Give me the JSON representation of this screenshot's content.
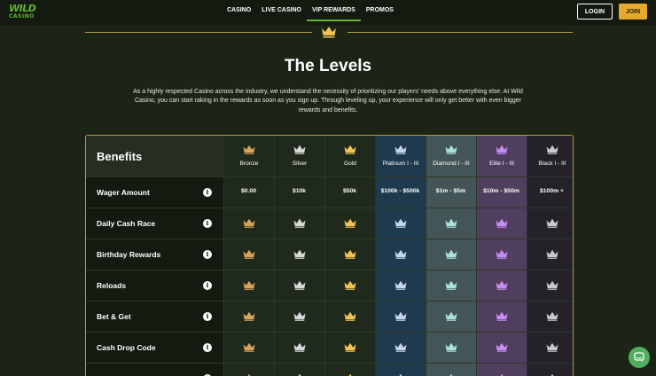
{
  "colors": {
    "accent_green": "#5fb533",
    "gold_line": "#b59a43",
    "join_bg": "#e5a92e",
    "bronze": "#d9a35b",
    "silver": "#d8d8d8",
    "gold": "#f3c453",
    "platinum": "#c5d3ee",
    "diamond": "#a9e3d8",
    "elite": "#c58cf2",
    "black": "#c9c9c9"
  },
  "header": {
    "logo": {
      "line1": "WILD",
      "line2": "CASINO"
    },
    "nav": [
      {
        "label": "CASINO",
        "active": false
      },
      {
        "label": "LIVE CASINO",
        "active": false
      },
      {
        "label": "VIP REWARDS",
        "active": true
      },
      {
        "label": "PROMOS",
        "active": false
      }
    ],
    "login_label": "LOGIN",
    "join_label": "JOIN"
  },
  "levels": {
    "title": "The Levels",
    "intro": "As a highly respected Casino across the industry, we understand the necessity of prioritizing our players' needs above everything else. At Wild Casino, you can start raking in the rewards as soon as you sign up. Through leveling up, your experience will only get better with even bigger rewards and benefits."
  },
  "table": {
    "benefits_label": "Benefits",
    "tiers": [
      {
        "name": "Bronze",
        "crown": "bronze-crown-icon",
        "color": "#d9a35b",
        "bg": "#1f2a1c"
      },
      {
        "name": "Silver",
        "crown": "silver-crown-icon",
        "color": "#d8d8d8",
        "bg": "#1f2a1c"
      },
      {
        "name": "Gold",
        "crown": "gold-crown-icon",
        "color": "#f3c453",
        "bg": "#1f2a1c"
      },
      {
        "name": "Platinum I - III",
        "crown": "platinum-crown-icon",
        "color": "#c5d3ee",
        "bg": "#1f3a4c"
      },
      {
        "name": "Diamond I - III",
        "crown": "diamond-crown-icon",
        "color": "#a9e3d8",
        "bg": "#435556"
      },
      {
        "name": "Elite I - III",
        "crown": "elite-crown-icon",
        "color": "#c58cf2",
        "bg": "#503e5f"
      },
      {
        "name": "Black I - III",
        "crown": "black-crown-icon",
        "color": "#c9c9c9",
        "bg": "#242128"
      }
    ],
    "rows": [
      {
        "label": "Wager Amount",
        "values": [
          "$0.00",
          "$10k",
          "$50k",
          "$100k - $500k",
          "$1m - $5m",
          "$10m - $50m",
          "$100m +"
        ]
      },
      {
        "label": "Daily Cash Race",
        "values": null
      },
      {
        "label": "Birthday Rewards",
        "values": null
      },
      {
        "label": "Reloads",
        "values": null
      },
      {
        "label": "Bet & Get",
        "values": null
      },
      {
        "label": "Cash Drop Code",
        "values": null
      },
      {
        "label": "",
        "values": null
      }
    ]
  },
  "chat": {
    "icon": "chat-icon"
  }
}
